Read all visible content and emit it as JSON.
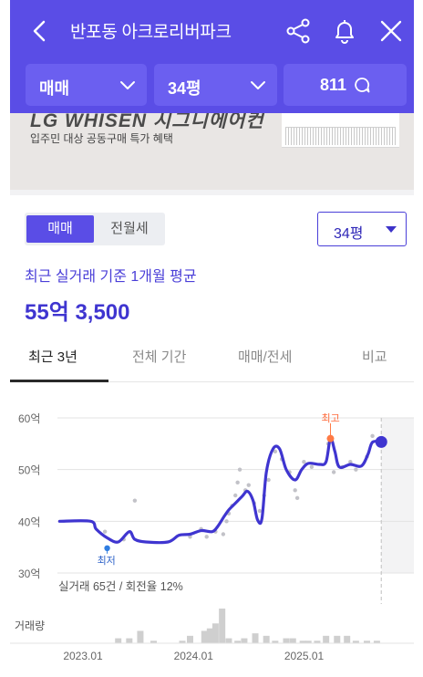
{
  "header": {
    "title": "반포동 아크로리버파크",
    "background_color": "#5a4de6",
    "icons": [
      "back-icon",
      "share-icon",
      "bell-icon",
      "close-icon"
    ]
  },
  "selectors": {
    "deal_type": "매매",
    "size": "34평",
    "comment_count": "811"
  },
  "banner": {
    "headline": "LG WHISEN 시그니에어컨",
    "subtext": "입주민 대상 공동구매 특가 혜택"
  },
  "segment": {
    "options": [
      "매매",
      "전월세"
    ],
    "selected": "매매"
  },
  "size_dropdown": "34평",
  "summary": {
    "label": "최근 실거래 기준 1개월 평균",
    "price": "55억 3,500"
  },
  "tabs": {
    "items": [
      "최근 3년",
      "전체 기간",
      "매매/전세",
      "비교"
    ],
    "active": "최근 3년"
  },
  "chart_data": {
    "type": "line",
    "y_tick_labels": [
      "60억",
      "50억",
      "40억",
      "30억"
    ],
    "y_ticks": [
      60,
      50,
      40,
      30
    ],
    "ylim": [
      30,
      60
    ],
    "x_tick_labels": [
      "2023.01",
      "2024.01",
      "2025.01"
    ],
    "x_ticks": [
      2023.0,
      2024.0,
      2025.0
    ],
    "xlim": [
      2022.75,
      2025.95
    ],
    "volume_label": "거래량",
    "max_label": "최고",
    "min_label": "최저",
    "footnote": "실거래 65건 / 회전율 12%",
    "line": {
      "color": "#3f35d0",
      "points": [
        [
          2022.77,
          40.0
        ],
        [
          2023.05,
          40.0
        ],
        [
          2023.1,
          38.5
        ],
        [
          2023.2,
          36.8
        ],
        [
          2023.3,
          36.0
        ],
        [
          2023.4,
          38.0
        ],
        [
          2023.45,
          36.5
        ],
        [
          2023.55,
          36.0
        ],
        [
          2023.75,
          36.0
        ],
        [
          2023.85,
          37.3
        ],
        [
          2023.95,
          37.5
        ],
        [
          2024.05,
          38.2
        ],
        [
          2024.15,
          38.0
        ],
        [
          2024.2,
          39.0
        ],
        [
          2024.26,
          41.0
        ],
        [
          2024.3,
          42.2
        ],
        [
          2024.36,
          43.5
        ],
        [
          2024.42,
          44.8
        ],
        [
          2024.47,
          45.8
        ],
        [
          2024.52,
          44.0
        ],
        [
          2024.56,
          40.3
        ],
        [
          2024.6,
          40.5
        ],
        [
          2024.64,
          49.5
        ],
        [
          2024.7,
          54.0
        ],
        [
          2024.76,
          54.0
        ],
        [
          2024.82,
          50.0
        ],
        [
          2024.9,
          48.0
        ],
        [
          2024.96,
          50.0
        ],
        [
          2025.02,
          51.2
        ],
        [
          2025.12,
          51.0
        ],
        [
          2025.18,
          51.5
        ],
        [
          2025.22,
          56.0
        ],
        [
          2025.26,
          53.5
        ],
        [
          2025.3,
          50.5
        ],
        [
          2025.4,
          51.0
        ],
        [
          2025.5,
          50.7
        ],
        [
          2025.56,
          53.0
        ],
        [
          2025.6,
          55.3
        ],
        [
          2025.68,
          55.35
        ]
      ]
    },
    "scatter": [
      [
        2023.18,
        38.0
      ],
      [
        2023.35,
        36.5
      ],
      [
        2023.45,
        44.0
      ],
      [
        2023.95,
        37.0
      ],
      [
        2024.05,
        38.5
      ],
      [
        2024.1,
        37.0
      ],
      [
        2024.18,
        38.0
      ],
      [
        2024.25,
        37.5
      ],
      [
        2024.28,
        40.0
      ],
      [
        2024.3,
        41.5
      ],
      [
        2024.33,
        43.0
      ],
      [
        2024.36,
        45.0
      ],
      [
        2024.38,
        47.5
      ],
      [
        2024.4,
        50.0
      ],
      [
        2024.45,
        46.0
      ],
      [
        2024.48,
        47.0
      ],
      [
        2024.53,
        43.5
      ],
      [
        2024.58,
        42.0
      ],
      [
        2024.62,
        45.0
      ],
      [
        2024.66,
        48.0
      ],
      [
        2024.72,
        53.5
      ],
      [
        2024.78,
        52.0
      ],
      [
        2024.85,
        49.5
      ],
      [
        2024.9,
        46.0
      ],
      [
        2024.92,
        44.5
      ],
      [
        2024.98,
        51.5
      ],
      [
        2025.05,
        50.5
      ],
      [
        2025.2,
        55.0
      ],
      [
        2025.25,
        49.5
      ],
      [
        2025.33,
        50.5
      ],
      [
        2025.4,
        51.5
      ],
      [
        2025.45,
        50.0
      ],
      [
        2025.55,
        52.5
      ],
      [
        2025.6,
        56.5
      ],
      [
        2025.64,
        55.5
      ]
    ],
    "max_point": [
      2025.22,
      56.0
    ],
    "min_point": [
      2023.2,
      34.8
    ],
    "last_point": [
      2025.68,
      55.35
    ],
    "volume": {
      "x": [
        2023.3,
        2023.4,
        2023.5,
        2023.62,
        2023.88,
        2023.95,
        2024.08,
        2024.13,
        2024.18,
        2024.24,
        2024.3,
        2024.38,
        2024.44,
        2024.54,
        2024.64,
        2024.72,
        2024.82,
        2024.88,
        2024.97,
        2025.02,
        2025.1,
        2025.18,
        2025.28,
        2025.37,
        2025.45,
        2025.55,
        2025.64
      ],
      "values": [
        2,
        2,
        5,
        1,
        1,
        3,
        5,
        6,
        8,
        14,
        2,
        1,
        2,
        4,
        3,
        1,
        2,
        2,
        1,
        1,
        1,
        3,
        3,
        3,
        1,
        1,
        1
      ]
    },
    "forecast_region_start": 2025.68,
    "grid": true
  }
}
